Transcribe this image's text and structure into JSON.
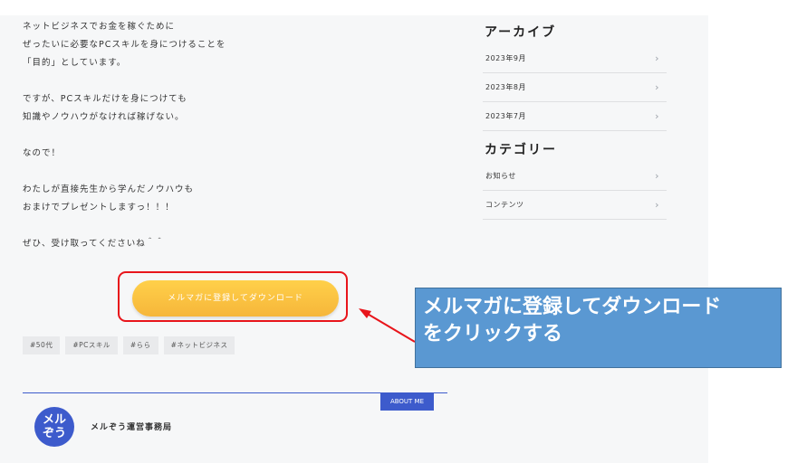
{
  "article": {
    "paragraphs": [
      [
        "ネットビジネスでお金を稼ぐために",
        "ぜったいに必要なPCスキルを身につけることを",
        "「目的」としています。"
      ],
      [
        "ですが、PCスキルだけを身につけても",
        "知識やノウハウがなければ稼げない。"
      ],
      [
        "なので！"
      ],
      [
        "わたしが直接先生から学んだノウハウも",
        "おまけでプレゼントしますっ！！！"
      ],
      [
        "ぜひ、受け取ってくださいね＾＾"
      ]
    ],
    "cta_label": "メルマガに登録してダウンロード",
    "tags": [
      "#50代",
      "#PCスキル",
      "#らら",
      "#ネットビジネス"
    ]
  },
  "about": {
    "button_label": "ABOUT ME",
    "avatar_line1": "メル",
    "avatar_line2": "ぞう",
    "author_name": "メルぞう運営事務局"
  },
  "sidebar": {
    "archive_title": "アーカイブ",
    "archive_items": [
      "2023年9月",
      "2023年8月",
      "2023年7月"
    ],
    "category_title": "カテゴリー",
    "category_items": [
      "お知らせ",
      "コンテンツ"
    ],
    "chevron_icon": "chevron-right-icon"
  },
  "callout": {
    "line1": "メルマガに登録してダウンロード",
    "line2": "をクリックする"
  },
  "colors": {
    "accent": "#3d5bcc",
    "cta": "#f6b63a",
    "highlight": "#e8151b",
    "callout_bg": "#5a98d2"
  }
}
